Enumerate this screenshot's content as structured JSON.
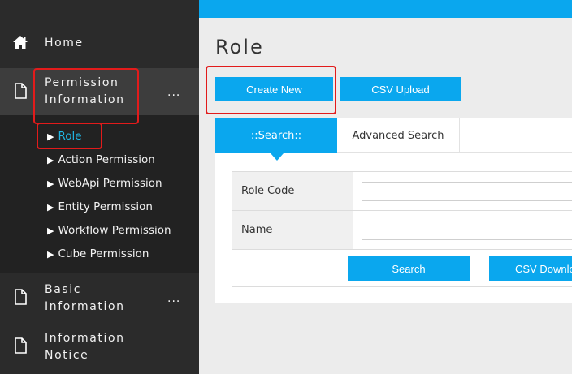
{
  "sidebar": {
    "home": {
      "label": "Home",
      "icon": "home-icon"
    },
    "permission": {
      "label_line1": "Permission",
      "label_line2": "Information",
      "more": "...",
      "icon": "document-icon"
    },
    "sub_items": [
      {
        "label": "Role",
        "active": true
      },
      {
        "label": "Action Permission"
      },
      {
        "label": "WebApi Permission"
      },
      {
        "label": "Entity Permission"
      },
      {
        "label": "Workflow Permission"
      },
      {
        "label": "Cube Permission"
      }
    ],
    "basic": {
      "label_line1": "Basic",
      "label_line2": "Information",
      "more": "...",
      "icon": "document-icon"
    },
    "notice": {
      "label_line1": "Information",
      "label_line2": "Notice",
      "icon": "document-icon"
    }
  },
  "main": {
    "title": "Role",
    "buttons": {
      "create_new": "Create New",
      "csv_upload": "CSV Upload"
    },
    "tabs": {
      "search": "::Search::",
      "advanced": "Advanced Search"
    },
    "form": {
      "fields": [
        {
          "label": "Role Code",
          "value": ""
        },
        {
          "label": "Name",
          "value": ""
        }
      ],
      "search_button": "Search",
      "csv_download_button": "CSV Downlo"
    }
  },
  "colors": {
    "accent": "#0aa7ee",
    "sidebar": "#2b2b2b",
    "active_link": "#20b5e3",
    "highlight": "#e21b1b"
  }
}
